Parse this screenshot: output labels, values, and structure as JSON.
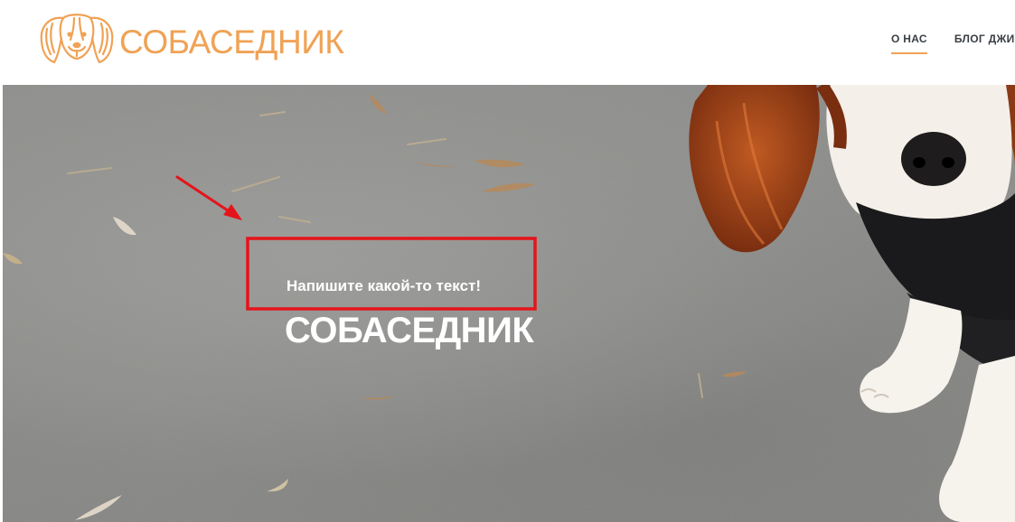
{
  "brand": {
    "name": "СОБАСЕДНИК",
    "color": "#f0a255"
  },
  "nav": {
    "items": [
      {
        "label": "О НАС",
        "active": true
      },
      {
        "label": "БЛОГ ДЖИ",
        "active": false
      }
    ]
  },
  "hero": {
    "subtitle": "Напишите какой-то текст!",
    "title": "СОБАСЕДНИК"
  },
  "annotation": {
    "color": "#e5141a"
  },
  "icons": {
    "logo": "dog-head-icon"
  }
}
